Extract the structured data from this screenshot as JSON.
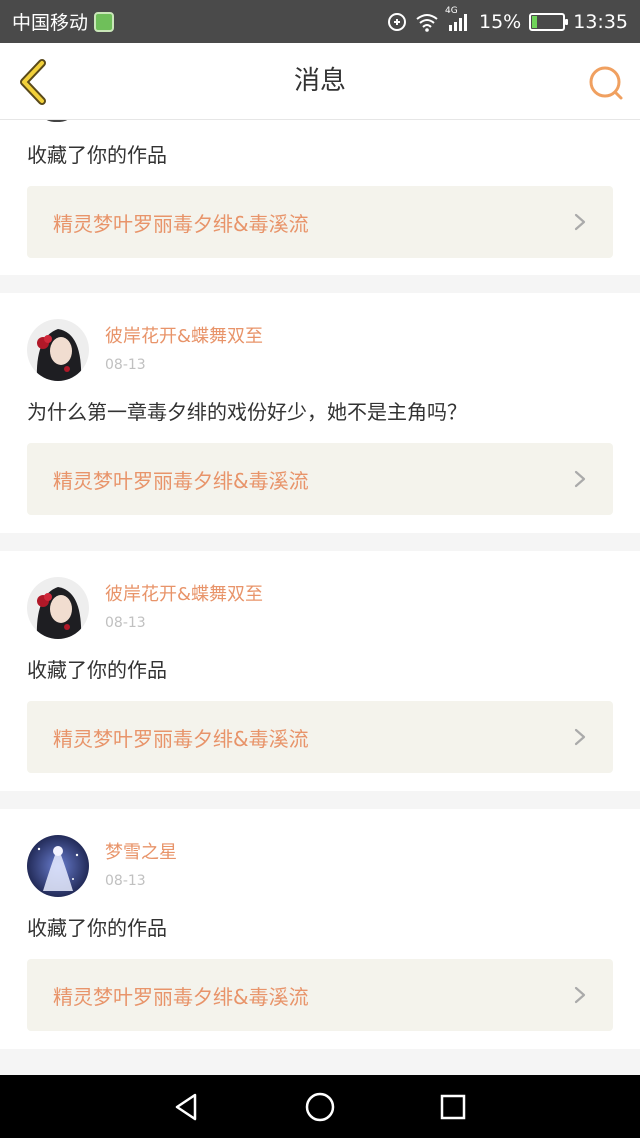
{
  "status_bar": {
    "carrier": "中国移动",
    "network": "4G",
    "battery": "15%",
    "battery_level": 0.15,
    "time": "13:35"
  },
  "header": {
    "title": "消息"
  },
  "messages": [
    {
      "text": "收藏了你的作品",
      "work_title": "精灵梦叶罗丽毒夕绯&毒溪流"
    },
    {
      "user": "彼岸花开&蝶舞双至",
      "date": "08-13",
      "text": "为什么第一章毒夕绯的戏份好少，她不是主角吗？",
      "work_title": "精灵梦叶罗丽毒夕绯&毒溪流"
    },
    {
      "user": "彼岸花开&蝶舞双至",
      "date": "08-13",
      "text": "收藏了你的作品",
      "work_title": "精灵梦叶罗丽毒夕绯&毒溪流"
    },
    {
      "user": "梦雪之星",
      "date": "08-13",
      "text": "收藏了你的作品",
      "work_title": "精灵梦叶罗丽毒夕绯&毒溪流"
    }
  ],
  "colors": {
    "accent": "#e8946a",
    "link_bg": "#f4f3ec",
    "status_bar": "#4a4a4a"
  },
  "icons": [
    "back-chevron-icon",
    "search-icon",
    "chevron-right-icon",
    "nav-back-triangle-icon",
    "nav-home-circle-icon",
    "nav-recents-square-icon"
  ]
}
